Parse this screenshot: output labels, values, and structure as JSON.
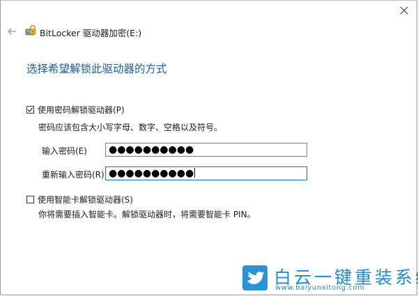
{
  "window": {
    "title": "BitLocker 驱动器加密(E:)",
    "close_glyph": "✕",
    "back_icon": "back-arrow-icon",
    "app_icon": "bitlocker-drive-icon"
  },
  "heading": "选择希望解锁此驱动器的方式",
  "password_option": {
    "checked": true,
    "label": "使用密码解锁驱动器(P)",
    "hint": "密码应该包含大小写字母、数字、空格以及符号。",
    "enter_label": "输入密码(E)",
    "enter_value": "●●●●●●●●●●",
    "reenter_label": "重新输入密码(R)",
    "reenter_value": "●●●●●●●●●●"
  },
  "smartcard_option": {
    "checked": false,
    "label": "使用智能卡解锁驱动器(S)",
    "hint": "你将需要插入智能卡。解锁驱动器时，将需要智能卡 PIN。"
  },
  "watermark": {
    "title": "白云一键重装系统",
    "url": "www.baiyunxitong.com",
    "logo_icon": "bird-logo-icon",
    "brand_color": "#1e8ad4"
  },
  "colors": {
    "heading": "#1d5a9e",
    "focus_border": "#1a6fc7"
  }
}
